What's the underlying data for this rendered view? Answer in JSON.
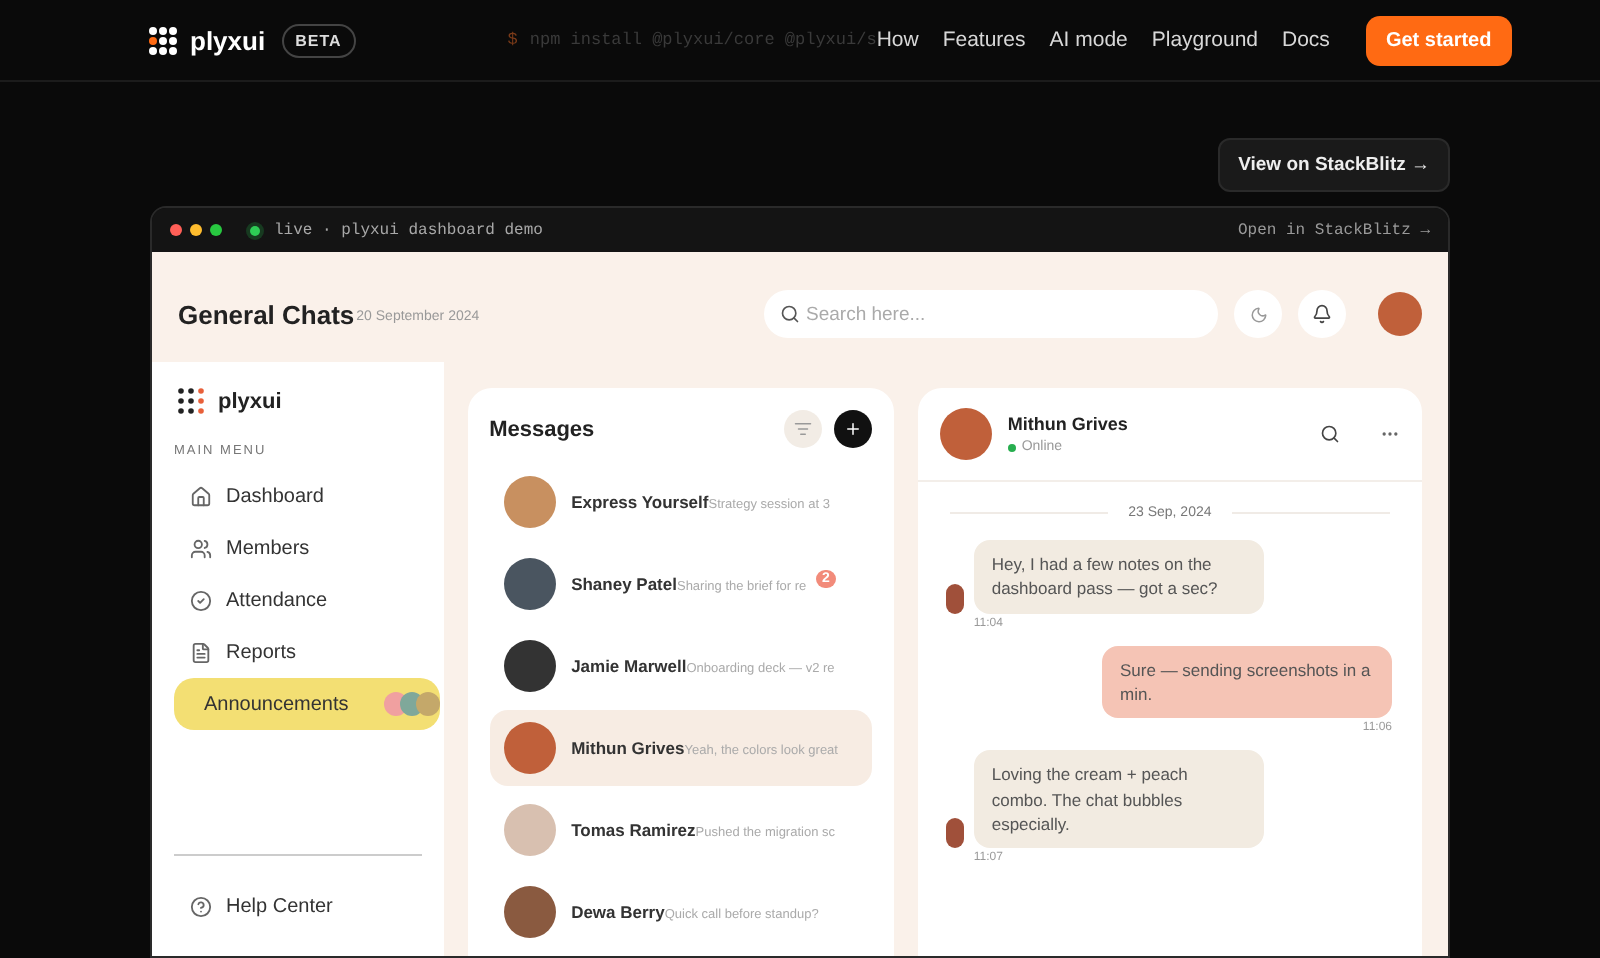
{
  "nav": {
    "brand": "plyxui",
    "badge": "BETA",
    "prompt": "$",
    "command": "npm install @plyxui/core @plyxui/s",
    "links": [
      "How",
      "Features",
      "AI mode",
      "Playground",
      "Docs"
    ],
    "cta": "Get started"
  },
  "stackblitz_button": "View on StackBlitz →",
  "demo": {
    "title": "live · plyxui dashboard demo",
    "open_link": "Open in StackBlitz →"
  },
  "header": {
    "title": "General Chats",
    "date": "20 September 2024",
    "search": {
      "placeholder": "Search here..."
    }
  },
  "sidebar": {
    "brand": "plyxui",
    "section": "MAIN MENU",
    "items": [
      {
        "label": "Dashboard",
        "selected": false
      },
      {
        "label": "Members",
        "selected": false
      },
      {
        "label": "Attendance",
        "selected": false
      },
      {
        "label": "Reports",
        "selected": false
      },
      {
        "label": "Announcements",
        "selected": true
      }
    ],
    "footer_items": [
      "Help Center"
    ]
  },
  "messages": {
    "title": "Messages",
    "items": [
      {
        "name": "Express Yourself",
        "preview": "Strategy session at 3",
        "selected": false
      },
      {
        "name": "Shaney Patel",
        "preview": "Sharing the brief for re",
        "badge": "2",
        "selected": false
      },
      {
        "name": "Jamie Marwell",
        "preview": "Onboarding deck — v2 re",
        "selected": false
      },
      {
        "name": "Mithun Grives",
        "preview": "Yeah, the colors look great",
        "selected": true
      },
      {
        "name": "Tomas Ramirez",
        "preview": "Pushed the migration sc",
        "selected": false
      },
      {
        "name": "Dewa Berry",
        "preview": "Quick call before standup?",
        "selected": false
      }
    ]
  },
  "chat": {
    "name": "Mithun Grives",
    "status": "Online",
    "date": "23 Sep, 2024",
    "messages": [
      {
        "kind": "incoming",
        "text": "Hey, I had a few notes on the dashboard pass — got a sec?",
        "time": "11:04"
      },
      {
        "kind": "outgoing",
        "text": "Sure — sending screenshots in a min.",
        "time": "11:06"
      },
      {
        "kind": "incoming",
        "text": "Loving the cream + peach combo. The chat bubbles especially.",
        "time": "11:07"
      }
    ]
  }
}
